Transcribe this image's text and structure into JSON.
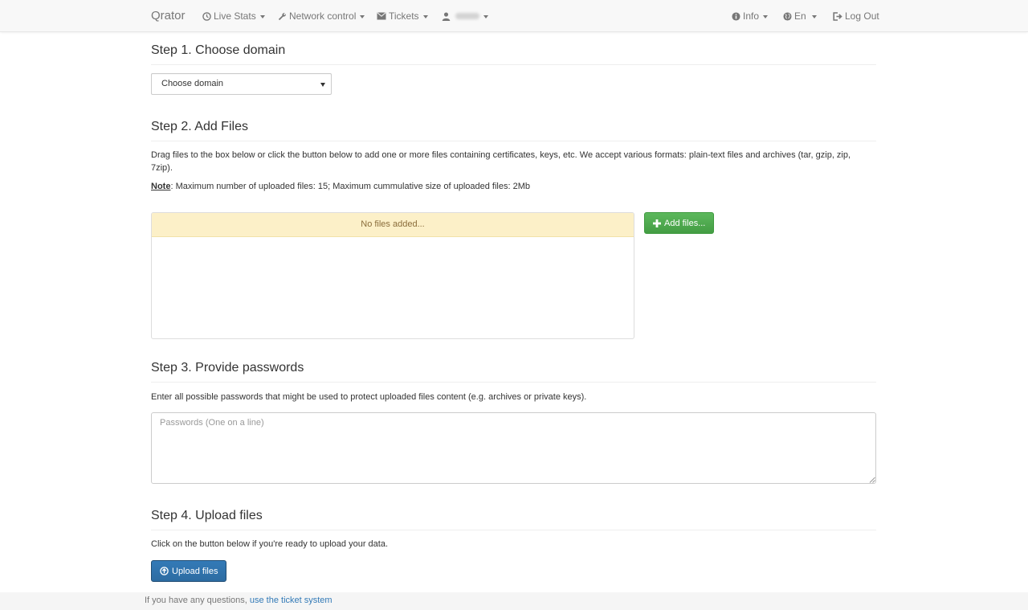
{
  "navbar": {
    "brand": "Qrator",
    "items": [
      {
        "label": "Live Stats",
        "icon": "clock-icon"
      },
      {
        "label": "Network control",
        "icon": "wrench-icon"
      },
      {
        "label": "Tickets",
        "icon": "envelope-icon"
      },
      {
        "label": "",
        "icon": "user-icon"
      }
    ],
    "right_items": [
      {
        "label": "Info",
        "icon": "info-circle-icon"
      },
      {
        "label": "En",
        "icon": "globe-icon"
      },
      {
        "label": "Log Out",
        "icon": "log-out-icon"
      }
    ]
  },
  "step1": {
    "heading": "Step 1. Choose domain",
    "select_value": "Choose domain"
  },
  "step2": {
    "heading": "Step 2. Add Files",
    "description": "Drag files to the box below or click the button below to add one or more files containing certificates, keys, etc. We accept various formats: plain-text files and archives (tar, gzip, zip, 7zip).",
    "note_label": "Note",
    "note_text": ": Maximum number of uploaded files: 15; Maximum cummulative size of uploaded files: 2Mb",
    "dropzone_empty": "No files added...",
    "add_button": "Add files..."
  },
  "step3": {
    "heading": "Step 3. Provide passwords",
    "description": "Enter all possible passwords that might be used to protect uploaded files content (e.g. archives or private keys).",
    "placeholder": "Passwords (One on a line)"
  },
  "step4": {
    "heading": "Step 4. Upload files",
    "description": "Click on the button below if you're ready to upload your data.",
    "upload_button": "Upload files"
  },
  "footer": {
    "text": "If you have any questions, ",
    "link": "use the ticket system"
  },
  "colors": {
    "success": "#5cb85c",
    "primary": "#337ab7",
    "warning_bg": "#fcf0c8",
    "link": "#337ab7"
  }
}
